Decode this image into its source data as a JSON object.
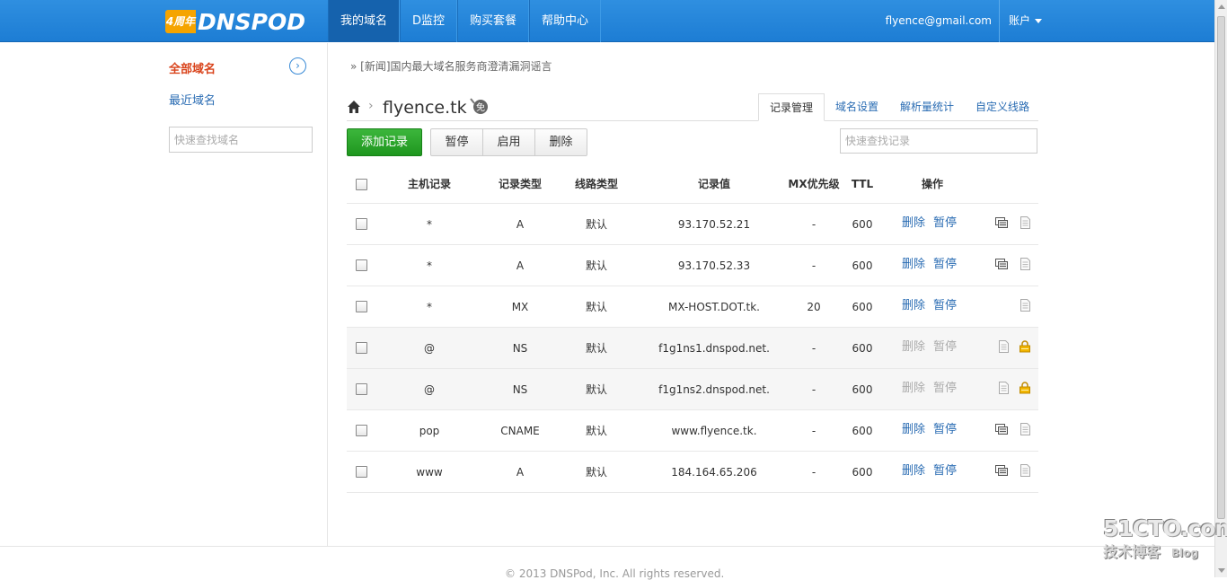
{
  "header": {
    "logo_badge": "4周年",
    "logo_text": "DNSPOD",
    "nav": [
      {
        "label": "我的域名",
        "active": true
      },
      {
        "label": "D监控",
        "active": false
      },
      {
        "label": "购买套餐",
        "active": false
      },
      {
        "label": "帮助中心",
        "active": false
      }
    ],
    "user_email": "flyence@gmail.com",
    "account_label": "账户"
  },
  "sidebar": {
    "all_domains": "全部域名",
    "recent_domains": "最近域名",
    "search_placeholder": "快速查找域名"
  },
  "main": {
    "news": "» [新闻]国内最大域名服务商澄清漏洞谣言",
    "domain": "flyence.tk",
    "free_badge": "免",
    "tabs": [
      "记录管理",
      "域名设置",
      "解析量统计",
      "自定义线路"
    ],
    "buttons": {
      "add": "添加记录",
      "pause": "暂停",
      "enable": "启用",
      "delete": "删除"
    },
    "record_search_placeholder": "快速查找记录"
  },
  "table": {
    "headers": [
      "主机记录",
      "记录类型",
      "线路类型",
      "记录值",
      "MX优先级",
      "TTL",
      "操作"
    ],
    "rows": [
      {
        "host": "*",
        "type": "A",
        "line": "默认",
        "value": "93.170.52.21",
        "mx": "-",
        "ttl": "600",
        "del": "删除",
        "pause": "暂停",
        "system": false,
        "remark": true
      },
      {
        "host": "*",
        "type": "A",
        "line": "默认",
        "value": "93.170.52.33",
        "mx": "-",
        "ttl": "600",
        "del": "删除",
        "pause": "暂停",
        "system": false,
        "remark": true
      },
      {
        "host": "*",
        "type": "MX",
        "line": "默认",
        "value": "MX-HOST.DOT.tk.",
        "mx": "20",
        "ttl": "600",
        "del": "删除",
        "pause": "暂停",
        "system": false,
        "remark": false
      },
      {
        "host": "@",
        "type": "NS",
        "line": "默认",
        "value": "f1g1ns1.dnspod.net.",
        "mx": "-",
        "ttl": "600",
        "del": "删除",
        "pause": "暂停",
        "system": true,
        "remark": false
      },
      {
        "host": "@",
        "type": "NS",
        "line": "默认",
        "value": "f1g1ns2.dnspod.net.",
        "mx": "-",
        "ttl": "600",
        "del": "删除",
        "pause": "暂停",
        "system": true,
        "remark": false
      },
      {
        "host": "pop",
        "type": "CNAME",
        "line": "默认",
        "value": "www.flyence.tk.",
        "mx": "-",
        "ttl": "600",
        "del": "删除",
        "pause": "暂停",
        "system": false,
        "remark": true
      },
      {
        "host": "www",
        "type": "A",
        "line": "默认",
        "value": "184.164.65.206",
        "mx": "-",
        "ttl": "600",
        "del": "删除",
        "pause": "暂停",
        "system": false,
        "remark": true
      }
    ]
  },
  "footer": {
    "copyright": "© 2013 DNSPod, Inc. All rights reserved."
  },
  "watermark": {
    "top": "51CTO.com",
    "bottom": "技术博客",
    "blog": "Blog"
  },
  "colors": {
    "header_blue": "#1d7dd4",
    "active_nav": "#1562ad",
    "link_blue": "#2a6cb3",
    "accent_red": "#d9441c",
    "add_green": "#1e961e",
    "lock_yellow": "#f2b600"
  }
}
